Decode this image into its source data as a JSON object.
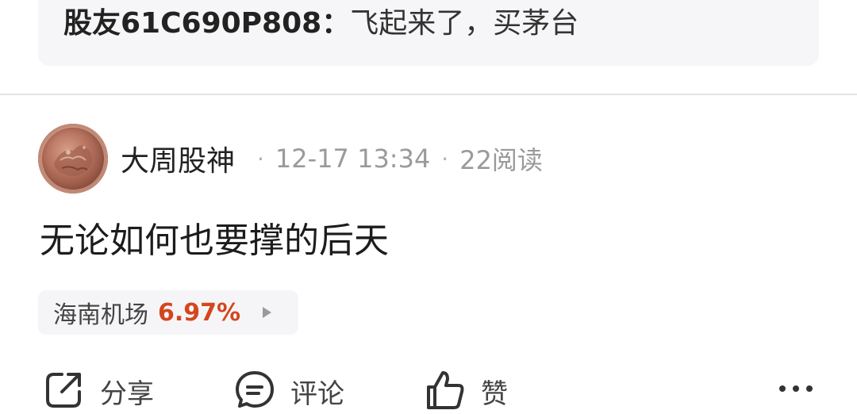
{
  "quote": {
    "username": "股友61C690P808",
    "separator": "：",
    "message": "飞起来了，买茅台"
  },
  "post": {
    "author": "大周股神",
    "date": "12-17 13:34",
    "reads": "22阅读",
    "dot": "·",
    "content": "无论如何也要撑的后天"
  },
  "stock": {
    "name": "海南机场",
    "change": "6.97%",
    "change_color": "#d4461f"
  },
  "actions": {
    "share": "分享",
    "comment": "评论",
    "like": "赞"
  }
}
